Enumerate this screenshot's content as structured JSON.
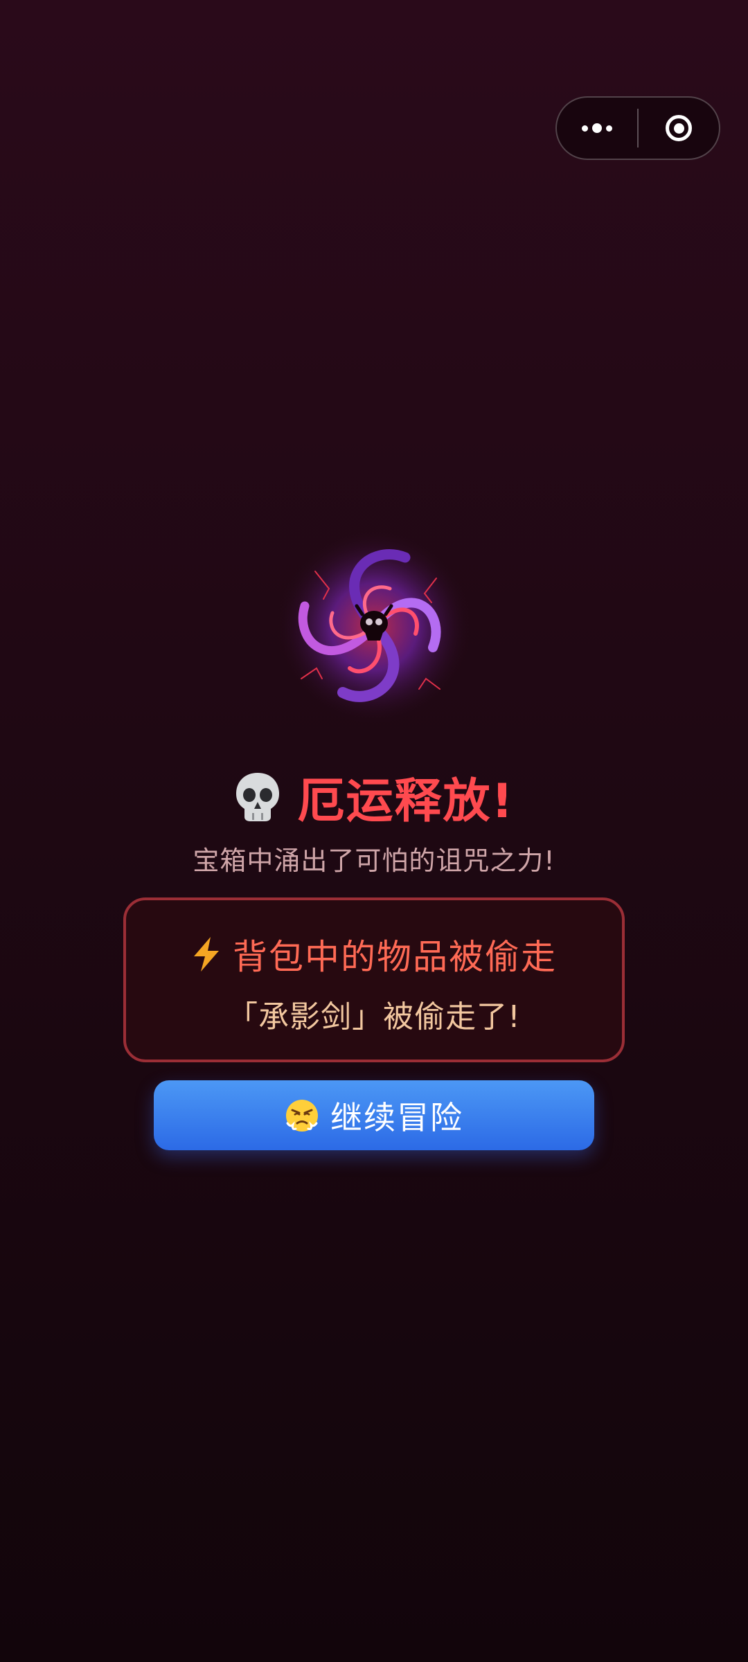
{
  "capsule": {
    "more_icon": "more-dots-icon",
    "close_icon": "target-close-icon"
  },
  "result": {
    "art_icon": "cursed-vortex-icon",
    "title_icon": "skull-icon",
    "title": "厄运释放!",
    "subtitle": "宝箱中涌出了可怕的诅咒之力!"
  },
  "event_card": {
    "icon": "lightning-icon",
    "title": "背包中的物品被偷走",
    "detail": "「承影剑」被偷走了!"
  },
  "continue_button": {
    "icon": "angry-face-icon",
    "label": "继续冒险"
  },
  "colors": {
    "title_red": "#ff4a4f",
    "card_border": "#9b2e36",
    "button_blue": "#3a80ee"
  }
}
